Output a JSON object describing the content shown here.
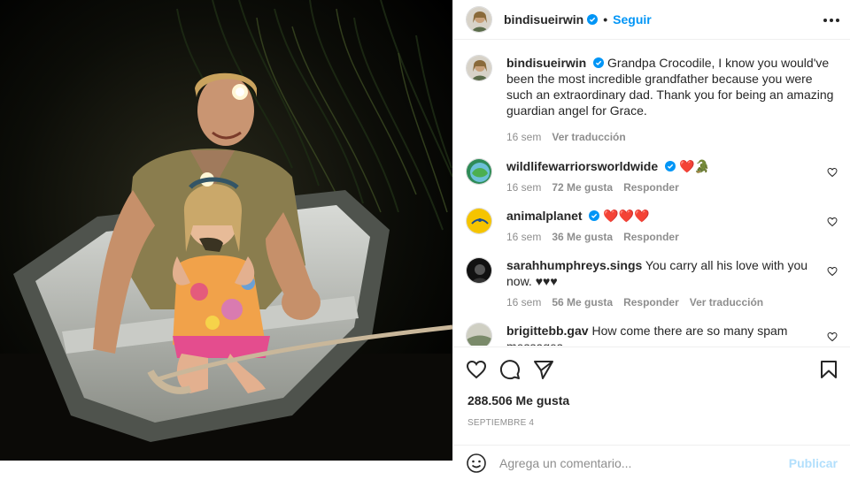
{
  "post": {
    "author": "bindisueirwin",
    "follow_label": "Seguir",
    "dot": "•",
    "more_icon": "more-icon"
  },
  "caption": {
    "author": "bindisueirwin",
    "text": "Grandpa Crocodile, I know you would've been the most incredible grandfather because you were such an extraordinary dad. Thank you for being an amazing guardian angel for Grace.",
    "time": "16 sem",
    "translate": "Ver traducción"
  },
  "comments": [
    {
      "author": "wildlifewarriorsworldwide",
      "text": "❤️🐊",
      "verified": true,
      "time": "16 sem",
      "likes": "72 Me gusta",
      "reply": "Responder"
    },
    {
      "author": "animalplanet",
      "text": "❤️❤️❤️",
      "verified": true,
      "time": "16 sem",
      "likes": "36 Me gusta",
      "reply": "Responder"
    },
    {
      "author": "sarahhumphreys.sings",
      "text": "You carry all his love with you now. ♥♥♥",
      "verified": false,
      "time": "16 sem",
      "likes": "56 Me gusta",
      "reply": "Responder",
      "translate": "Ver traducción"
    },
    {
      "author": "brigittebb.gav",
      "text": "How come there are so many spam messages",
      "verified": false
    }
  ],
  "actions": {
    "likes": "288.506 Me gusta",
    "date": "SEPTIEMBRE 4"
  },
  "add_comment": {
    "placeholder": "Agrega un comentario...",
    "publish": "Publicar"
  },
  "colors": {
    "accent": "#0095f6",
    "verified": "#0095f6",
    "heart": "#ed4956",
    "muted": "#8e8e8e"
  }
}
